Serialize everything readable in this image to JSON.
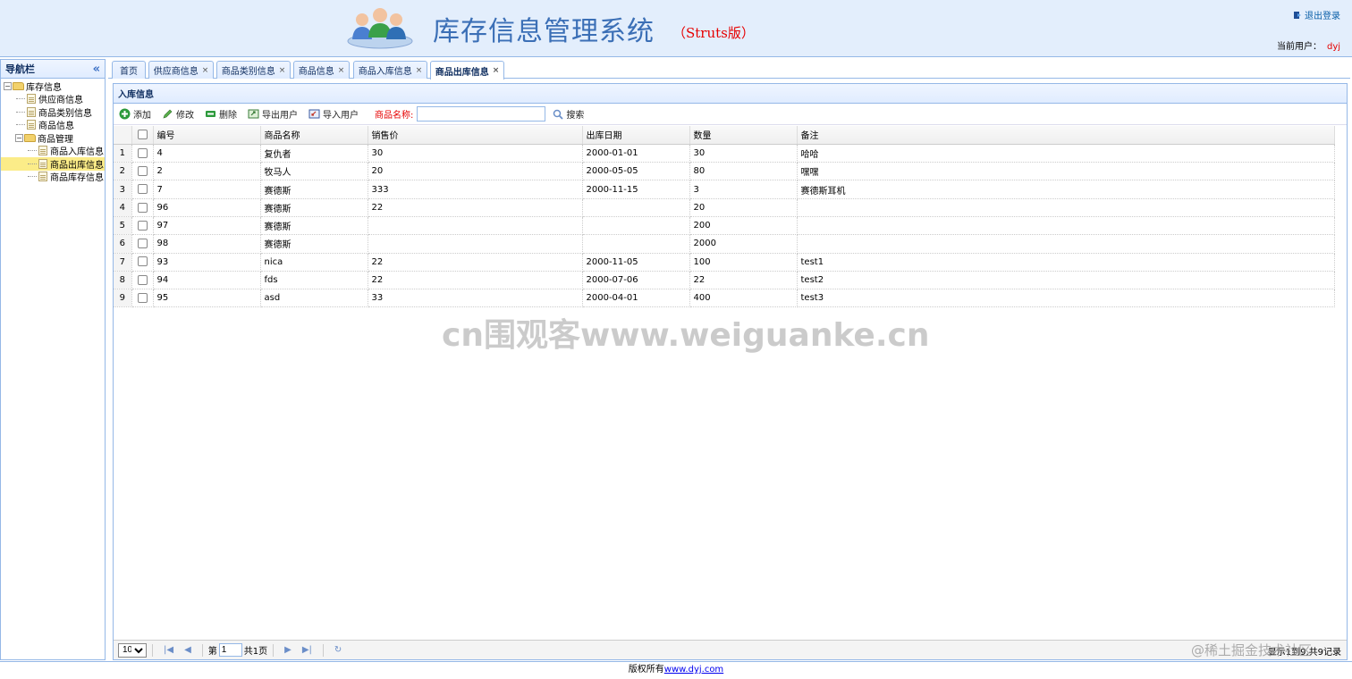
{
  "header": {
    "title": "库存信息管理系统",
    "subtitle": "（Struts版）",
    "logout_label": "退出登录",
    "current_user_label": "当前用户：",
    "current_user_name": "dyj"
  },
  "sidebar": {
    "title": "导航栏",
    "tree": [
      {
        "label": "库存信息",
        "type": "folder"
      },
      {
        "label": "供应商信息",
        "type": "file"
      },
      {
        "label": "商品类别信息",
        "type": "file"
      },
      {
        "label": "商品信息",
        "type": "file"
      },
      {
        "label": "商品管理",
        "type": "folder"
      },
      {
        "label": "商品入库信息",
        "type": "file"
      },
      {
        "label": "商品出库信息",
        "type": "file",
        "selected": true
      },
      {
        "label": "商品库存信息",
        "type": "file"
      }
    ]
  },
  "tabs": [
    {
      "label": "首页",
      "closable": false
    },
    {
      "label": "供应商信息",
      "closable": true
    },
    {
      "label": "商品类别信息",
      "closable": true
    },
    {
      "label": "商品信息",
      "closable": true
    },
    {
      "label": "商品入库信息",
      "closable": true
    },
    {
      "label": "商品出库信息",
      "closable": true,
      "active": true
    }
  ],
  "panel": {
    "title": "入库信息"
  },
  "toolbar": {
    "add_label": "添加",
    "edit_label": "修改",
    "delete_label": "删除",
    "export_label": "导出用户",
    "import_label": "导入用户",
    "search_label": "商品名称:",
    "search_value": "",
    "search_button_label": "搜索"
  },
  "grid": {
    "columns": [
      "编号",
      "商品名称",
      "销售价",
      "出库日期",
      "数量",
      "备注"
    ],
    "rows": [
      [
        "4",
        "复仇者",
        "30",
        "2000-01-01",
        "30",
        "哈哈"
      ],
      [
        "2",
        "牧马人",
        "20",
        "2000-05-05",
        "80",
        "嘿嘿"
      ],
      [
        "7",
        "赛德斯",
        "333",
        "2000-11-15",
        "3",
        "赛德斯耳机"
      ],
      [
        "96",
        "赛德斯",
        "22",
        "",
        "20",
        ""
      ],
      [
        "97",
        "赛德斯",
        "",
        "",
        "200",
        ""
      ],
      [
        "98",
        "赛德斯",
        "",
        "",
        "2000",
        ""
      ],
      [
        "93",
        "nica",
        "22",
        "2000-11-05",
        "100",
        "test1"
      ],
      [
        "94",
        "fds",
        "22",
        "2000-07-06",
        "22",
        "test2"
      ],
      [
        "95",
        "asd",
        "33",
        "2000-04-01",
        "400",
        "test3"
      ]
    ]
  },
  "pager": {
    "page_size": "10",
    "page_prefix": "第",
    "page_value": "1",
    "page_total": "共1页",
    "info": "显示1到9,共9记录"
  },
  "footer": {
    "text": "版权所有",
    "link": "www.dyj.com"
  },
  "watermark": "cn围观客www.weiguanke.cn",
  "corner_watermark": "@稀土掘金技术社区",
  "colors": {
    "header_bg": "#e3eefc",
    "border": "#95b8e7",
    "title_blue": "#3b6fb6",
    "accent_red": "#e60000",
    "selected_bg": "#fbec88"
  }
}
